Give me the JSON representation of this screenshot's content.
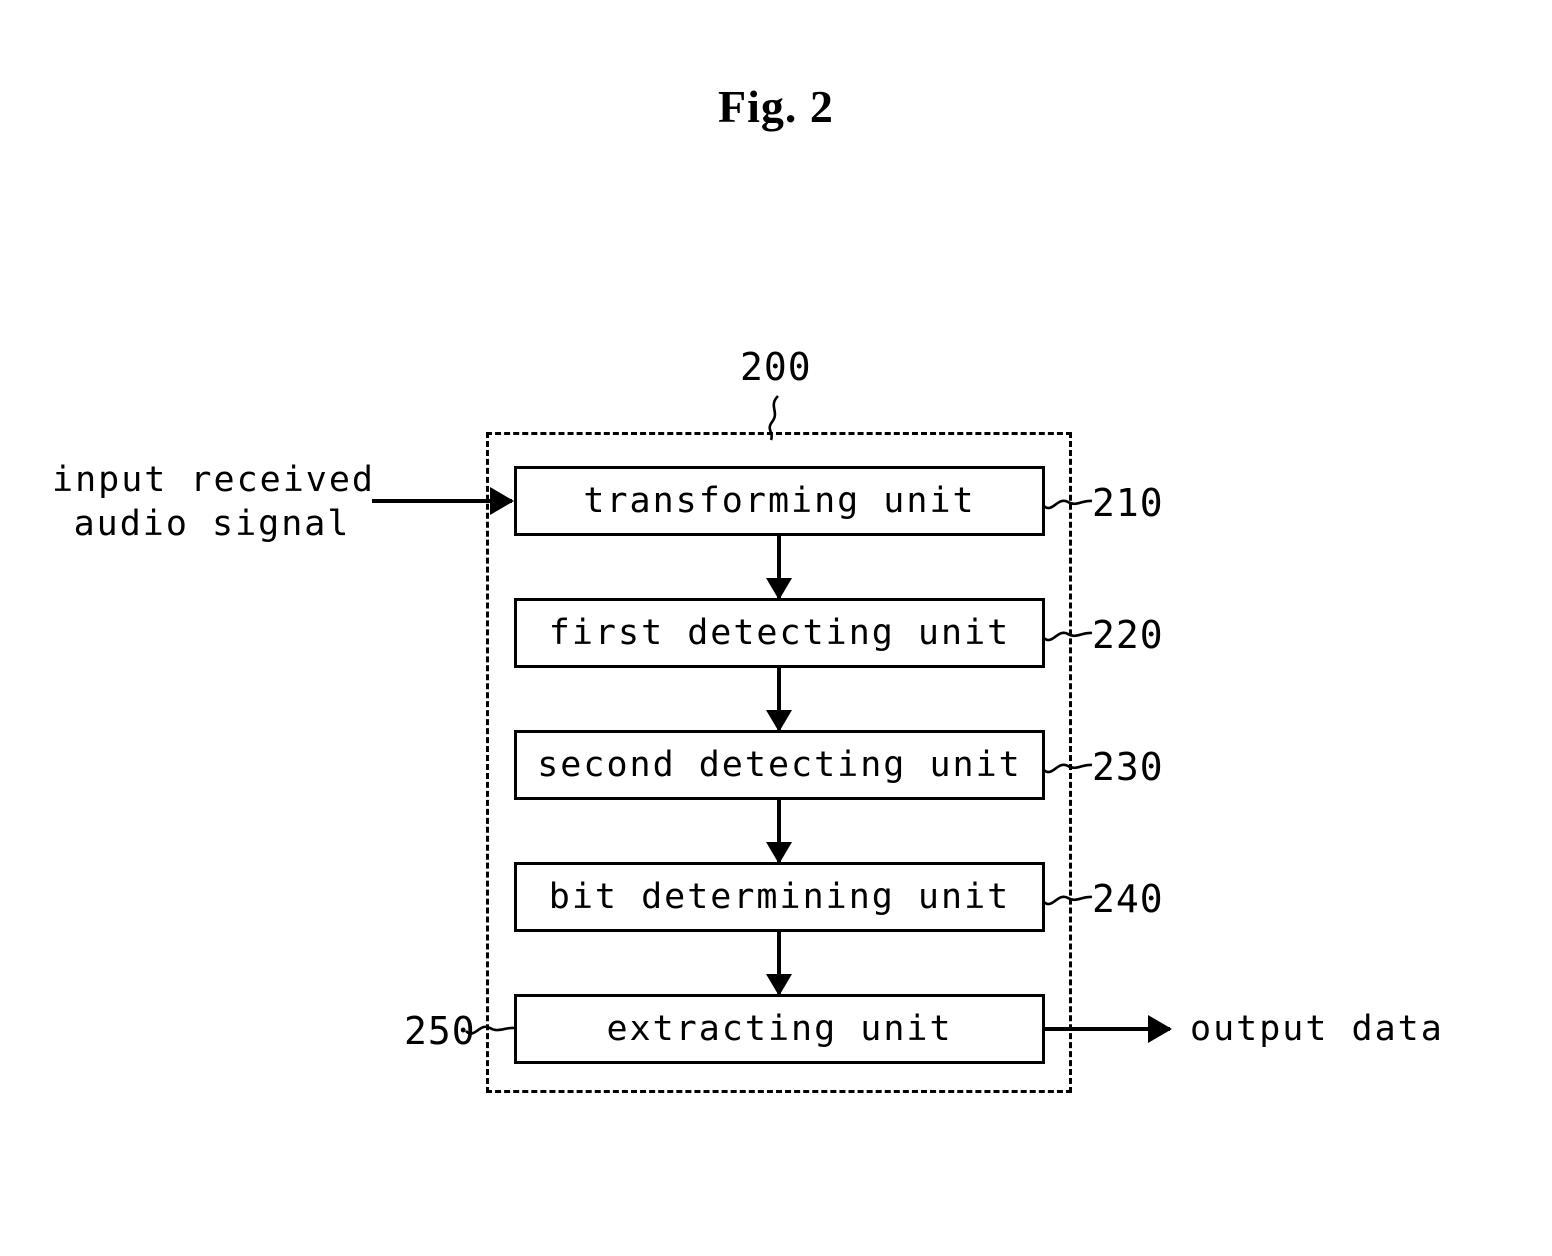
{
  "figure": {
    "title": "Fig. 2",
    "system_ref": "200"
  },
  "io": {
    "input_line1": "input received",
    "input_line2": "audio signal",
    "output": "output data"
  },
  "units": [
    {
      "label": "transforming unit",
      "ref": "210",
      "ref_side": "right"
    },
    {
      "label": "first detecting unit",
      "ref": "220",
      "ref_side": "right"
    },
    {
      "label": "second detecting unit",
      "ref": "230",
      "ref_side": "right"
    },
    {
      "label": "bit determining unit",
      "ref": "240",
      "ref_side": "right"
    },
    {
      "label": "extracting unit",
      "ref": "250",
      "ref_side": "left"
    }
  ],
  "colors": {
    "ink": "#000000",
    "paper": "#ffffff"
  }
}
